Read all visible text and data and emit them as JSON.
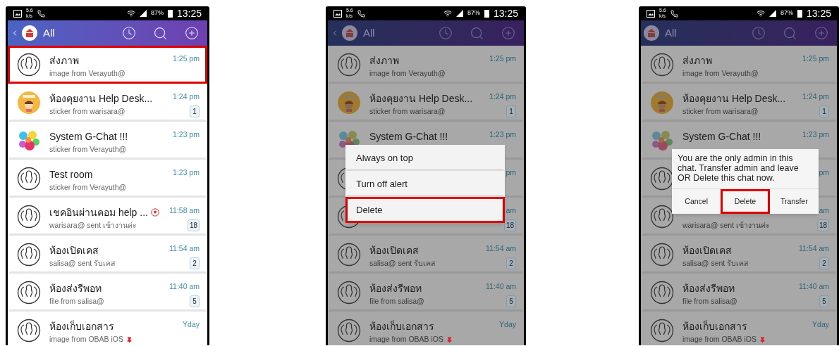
{
  "phones": [
    {
      "dimmed": false,
      "status_bar": {
        "speed_value": "5.6",
        "speed_unit": "k/s",
        "battery": "87%",
        "time": "13:25"
      },
      "header": {
        "back": true,
        "title": "All"
      },
      "chats": [
        {
          "avatar": {
            "kind": "group"
          },
          "title": "ส่งภาพ",
          "subtitle": "image from Verayuth@",
          "time": "1:25 pm",
          "highlighted": true
        },
        {
          "avatar": {
            "kind": "sticker"
          },
          "title": "ห้องคุยงาน Help Desk...",
          "subtitle": "sticker from warisara@",
          "time": "1:24 pm",
          "badge": "1",
          "highlighted": false
        },
        {
          "avatar": {
            "kind": "bubbles"
          },
          "title": "System G-Chat !!!",
          "subtitle": "sticker from Verayuth@",
          "time": "1:23 pm",
          "highlighted": false
        },
        {
          "avatar": {
            "kind": "group"
          },
          "title": "Test room",
          "subtitle": "sticker from Verayuth@",
          "time": "1:23 pm",
          "highlighted": false
        },
        {
          "avatar": {
            "kind": "group"
          },
          "title": "เชคอินผ่านคอม help ...",
          "location": true,
          "subtitle": "warisara@ sent เข้างานค่ะ",
          "time": "11:58 am",
          "badge": "18",
          "highlighted": false
        },
        {
          "avatar": {
            "kind": "group"
          },
          "title": "ห้องเปิดเคส",
          "subtitle": "salisa@ sent รับเคส",
          "time": "11:54 am",
          "badge": "2",
          "highlighted": false
        },
        {
          "avatar": {
            "kind": "group"
          },
          "title": "ห้องส่งรีพอท",
          "subtitle": "file from salisa@",
          "time": "11:40 am",
          "badge": "5",
          "highlighted": false
        },
        {
          "avatar": {
            "kind": "group"
          },
          "title": "ห้องเก็บเอกสาร",
          "subtitle": "image from OBAB iOS",
          "pinned": true,
          "time": "Yday",
          "highlighted": false
        }
      ]
    },
    {
      "dimmed": true,
      "status_bar": {
        "speed_value": "5.6",
        "speed_unit": "k/s",
        "battery": "87%",
        "time": "13:25"
      },
      "header": {
        "back": true,
        "title": "All"
      },
      "chats": [
        {
          "avatar": {
            "kind": "group"
          },
          "title": "ส่งภาพ",
          "subtitle": "image from Verayuth@",
          "time": "1:25 pm",
          "highlighted": false
        },
        {
          "avatar": {
            "kind": "sticker"
          },
          "title": "ห้องคุยงาน Help Desk...",
          "subtitle": "sticker from warisara@",
          "time": "1:24 pm",
          "badge": "1",
          "highlighted": false
        },
        {
          "avatar": {
            "kind": "bubbles"
          },
          "title": "System G-Chat !!!",
          "time": "1:23 pm",
          "highlighted": false
        },
        {
          "avatar": {
            "kind": "group"
          },
          "time": "pm",
          "highlighted": false
        },
        {
          "avatar": {
            "kind": "group"
          },
          "time": "am",
          "badge": "18",
          "highlighted": false
        },
        {
          "avatar": {
            "kind": "group"
          },
          "title": "ห้องเปิดเคส",
          "subtitle": "salisa@ sent รับเคส",
          "time": "11:54 am",
          "badge": "2",
          "highlighted": false
        },
        {
          "avatar": {
            "kind": "group"
          },
          "title": "ห้องส่งรีพอท",
          "subtitle": "file from salisa@",
          "time": "11:40 am",
          "badge": "5",
          "highlighted": false
        },
        {
          "avatar": {
            "kind": "group"
          },
          "title": "ห้องเก็บเอกสาร",
          "subtitle": "image from OBAB iOS",
          "pinned": true,
          "time": "Yday",
          "highlighted": false
        }
      ],
      "overlay": {
        "kind": "menu",
        "items": [
          {
            "label": "Always on top",
            "highlighted": false
          },
          {
            "label": "Turn off alert",
            "highlighted": false
          },
          {
            "label": "Delete",
            "highlighted": true
          }
        ]
      }
    },
    {
      "dimmed": true,
      "status_bar": {
        "speed_value": "5.6",
        "speed_unit": "k/s",
        "battery": "87%",
        "time": "13:25"
      },
      "header": {
        "back": false,
        "title": "All"
      },
      "chats": [
        {
          "avatar": {
            "kind": "group"
          },
          "title": "ส่งภาพ",
          "subtitle": "image from Verayuth@",
          "time": "1:25 pm",
          "highlighted": false
        },
        {
          "avatar": {
            "kind": "sticker"
          },
          "title": "ห้องคุยงาน Help Desk...",
          "subtitle": "sticker from warisara@",
          "time": "1:24 pm",
          "badge": "1",
          "highlighted": false
        },
        {
          "avatar": {
            "kind": "bubbles"
          },
          "title": "System G-Chat !!!",
          "time": "1:23 pm",
          "highlighted": false
        },
        {
          "avatar": {
            "kind": "group"
          },
          "time": "pm",
          "highlighted": false
        },
        {
          "avatar": {
            "kind": "group"
          },
          "subtitle": "warisara@ sent เข้างานค่ะ",
          "time": "am",
          "badge": "18",
          "highlighted": false
        },
        {
          "avatar": {
            "kind": "group"
          },
          "title": "ห้องเปิดเคส",
          "subtitle": "salisa@ sent รับเคส",
          "time": "11:54 am",
          "badge": "2",
          "highlighted": false
        },
        {
          "avatar": {
            "kind": "group"
          },
          "title": "ห้องส่งรีพอท",
          "subtitle": "file from salisa@",
          "time": "11:40 am",
          "badge": "5",
          "highlighted": false
        },
        {
          "avatar": {
            "kind": "group"
          },
          "title": "ห้องเก็บเอกสาร",
          "subtitle": "image from OBAB iOS",
          "pinned": true,
          "time": "Yday",
          "highlighted": false
        }
      ],
      "overlay": {
        "kind": "dialog",
        "message": "You are the only admin in this chat. Transfer admin and leave OR Delete this chat now.",
        "buttons": [
          {
            "label": "Cancel",
            "highlighted": false
          },
          {
            "label": "Delete",
            "highlighted": true
          },
          {
            "label": "Transfer",
            "highlighted": false
          }
        ]
      }
    }
  ]
}
